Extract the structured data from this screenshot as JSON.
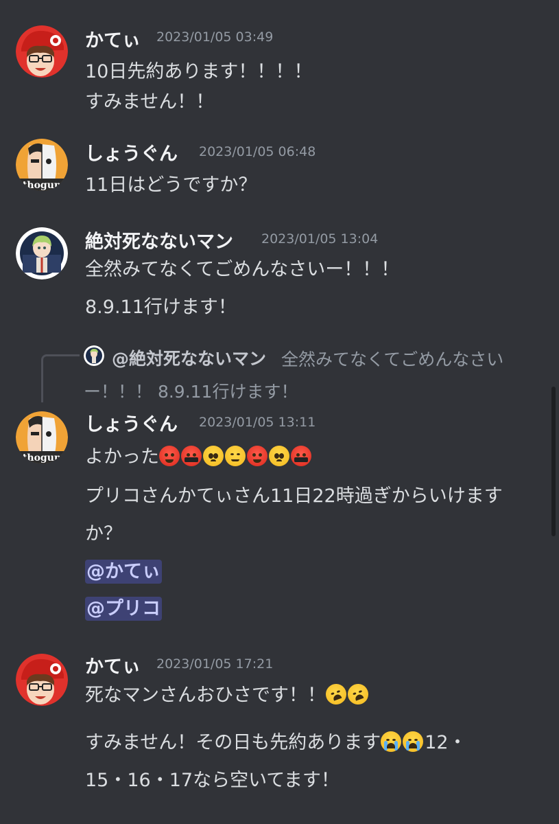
{
  "messages": [
    {
      "author": "かてぃ",
      "timestamp": "2023/01/05 03:49",
      "avatar_icon": "red-cap-glasses-avatar",
      "lines": [
        "10日先約あります！！！！",
        "すみません！！"
      ]
    },
    {
      "author": "しょうぐん",
      "timestamp": "2023/01/05 06:48",
      "avatar_icon": "half-face-avatar",
      "avatar_text": "thogun",
      "lines": [
        "11日はどうですか？"
      ]
    },
    {
      "author": "絶対死なないマン",
      "timestamp": "2023/01/05 13:04",
      "avatar_icon": "anime-character-avatar",
      "lines": [
        "全然みてなくてごめんなさいー！！！",
        "8.9.11行けます！"
      ]
    },
    {
      "reply": {
        "author": "@絶対死なないマン",
        "text_line1": "全然みてなくてごめんなさい",
        "text_line2": "ー！！！ 8.9.11行けます！"
      },
      "author": "しょうぐん",
      "timestamp": "2023/01/05 13:11",
      "avatar_icon": "half-face-avatar",
      "avatar_text": "thogun",
      "text_prefix": "よかった",
      "emojis": [
        "angry-face-emoji",
        "cursing-face-emoji",
        "pleading-face-emoji",
        "unamused-face-emoji",
        "angry-face-emoji",
        "pleading-face-emoji",
        "cursing-face-emoji"
      ],
      "lines": [
        "プリコさんかてぃさん11日22時過ぎからいけます",
        "か？"
      ],
      "mentions": [
        "@かてぃ",
        "@プリコ"
      ]
    },
    {
      "author": "かてぃ",
      "timestamp": "2023/01/05 17:21",
      "avatar_icon": "red-cap-glasses-avatar",
      "line1_text": "死なマンさんおひさです！！",
      "line1_emojis": [
        "rolling-on-floor-laughing-emoji",
        "rolling-on-floor-laughing-emoji"
      ],
      "line2_text": "すみません！その日も先約あります",
      "line2_emojis": [
        "loudly-crying-face-emoji",
        "loudly-crying-face-emoji"
      ],
      "line2_suffix": "12・",
      "line3_text": "15・16・17なら空いてます！"
    }
  ],
  "colors": {
    "background": "#313338",
    "mention_bg": "#3e4274",
    "mention_fg": "#c9cdfb",
    "timestamp": "#949ba4"
  }
}
